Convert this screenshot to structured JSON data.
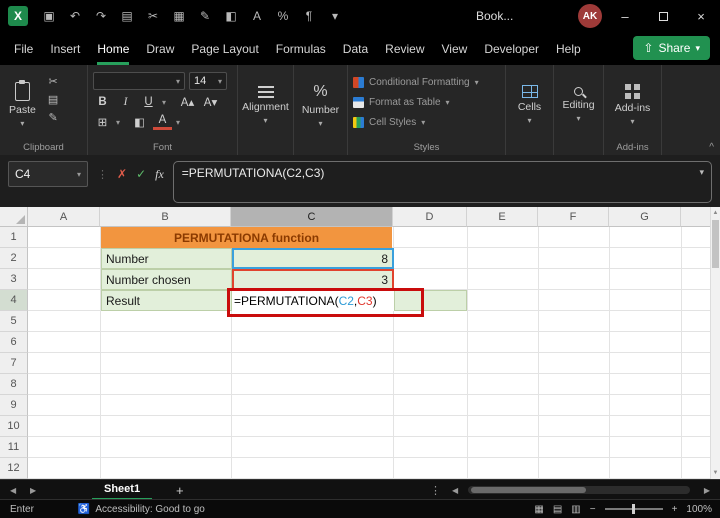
{
  "glyphs": {
    "chevron_down": "▾",
    "caret_up": "^",
    "vdots": "⋮",
    "left": "◀",
    "right": "▶",
    "up": "▲",
    "down": "▼",
    "plus": "+",
    "minus": "−",
    "share_arrow": "⇧",
    "accessibility": "♿",
    "view_normal": "▦",
    "view_layout": "▤",
    "view_break": "▥"
  },
  "titlebar": {
    "logo": "X",
    "qat": [
      "▣",
      "↶",
      "↷",
      "▤",
      "✂",
      "▦",
      "✎",
      "◧",
      "A",
      "%",
      "¶",
      "▾"
    ],
    "title": "Book...",
    "avatar": "AK",
    "minimize": "–",
    "close": "×"
  },
  "menubar": {
    "items": [
      "File",
      "Insert",
      "Home",
      "Draw",
      "Page Layout",
      "Formulas",
      "Data",
      "Review",
      "View",
      "Developer",
      "Help"
    ],
    "share_label": "Share"
  },
  "ribbon": {
    "paste_label": "Paste",
    "clipboard_group": "Clipboard",
    "cut_icon": "✂",
    "copy_icon": "▤",
    "painter_icon": "✎",
    "font_name": "",
    "font_size": "14",
    "bold": "B",
    "italic": "I",
    "underline": "U",
    "grow_font": "A▴",
    "shrink_font": "A▾",
    "borders_icon": "⊞",
    "fill_icon": "◧",
    "font_color_icon": "A",
    "font_group": "Font",
    "alignment_label": "Alignment",
    "number_icon": "%",
    "number_label": "Number",
    "styles_items": [
      "Conditional Formatting",
      "Format as Table",
      "Cell Styles"
    ],
    "styles_group": "Styles",
    "cells_label": "Cells",
    "editing_label": "Editing",
    "addins_label": "Add-ins",
    "addins_group": "Add-ins"
  },
  "formula_bar": {
    "name_box": "C4",
    "cancel": "✗",
    "enter": "✓",
    "fx": "fx",
    "formula": {
      "prefix": "=PERMUTATIONA(",
      "ref1": "C2",
      "sep": ",",
      "ref2": "C3",
      "close": ")"
    }
  },
  "grid": {
    "columns": [
      "A",
      "B",
      "C",
      "D",
      "E",
      "F",
      "G"
    ],
    "rows": [
      "1",
      "2",
      "3",
      "4",
      "5",
      "6",
      "7",
      "8",
      "9",
      "10",
      "11",
      "12"
    ],
    "cells": {
      "title": "PERMUTATIONA function",
      "b2": "Number",
      "c2": "8",
      "b3": "Number chosen",
      "c3": "3",
      "b4": "Result",
      "c4": {
        "prefix": "=PERMUTATIONA(",
        "ref1": "C2",
        "sep": ",",
        "ref2": "C3",
        "close": ")"
      }
    }
  },
  "sheet_bar": {
    "tab": "Sheet1"
  },
  "status_bar": {
    "mode": "Enter",
    "accessibility": "Accessibility: Good to go",
    "zoom": "100%"
  },
  "colors": {
    "accent_green": "#27A05C",
    "header_orange": "#F2953F",
    "light_green": "#E2EFDA",
    "ref_blue": "#2E9BD6",
    "ref_red": "#E0382E",
    "annotation_red": "#C90C0C"
  }
}
